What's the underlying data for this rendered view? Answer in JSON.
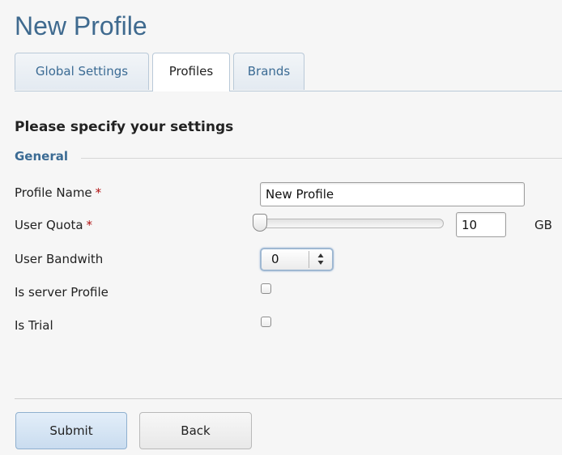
{
  "page": {
    "title": "New Profile"
  },
  "tabs": [
    {
      "label": "Global Settings",
      "active": false
    },
    {
      "label": "Profiles",
      "active": true
    },
    {
      "label": "Brands",
      "active": false
    }
  ],
  "form": {
    "heading": "Please specify your settings",
    "section_legend": "General",
    "required_marker": "*",
    "fields": {
      "profile_name": {
        "label": "Profile Name",
        "value": "New Profile",
        "required": true
      },
      "user_quota": {
        "label": "User Quota",
        "value": "10",
        "unit": "GB",
        "slider_fraction": 0.0,
        "required": true
      },
      "user_bandwidth": {
        "label": "User Bandwith",
        "value": "0"
      },
      "is_server_profile": {
        "label": "Is server Profile",
        "checked": false
      },
      "is_trial": {
        "label": "Is Trial",
        "checked": false
      }
    }
  },
  "buttons": {
    "submit": "Submit",
    "back": "Back"
  },
  "icons": {
    "stepper": "up-down-arrows-icon"
  },
  "colors": {
    "title": "#3f6a8f",
    "accent": "#3b6b94",
    "required": "#b01010"
  }
}
